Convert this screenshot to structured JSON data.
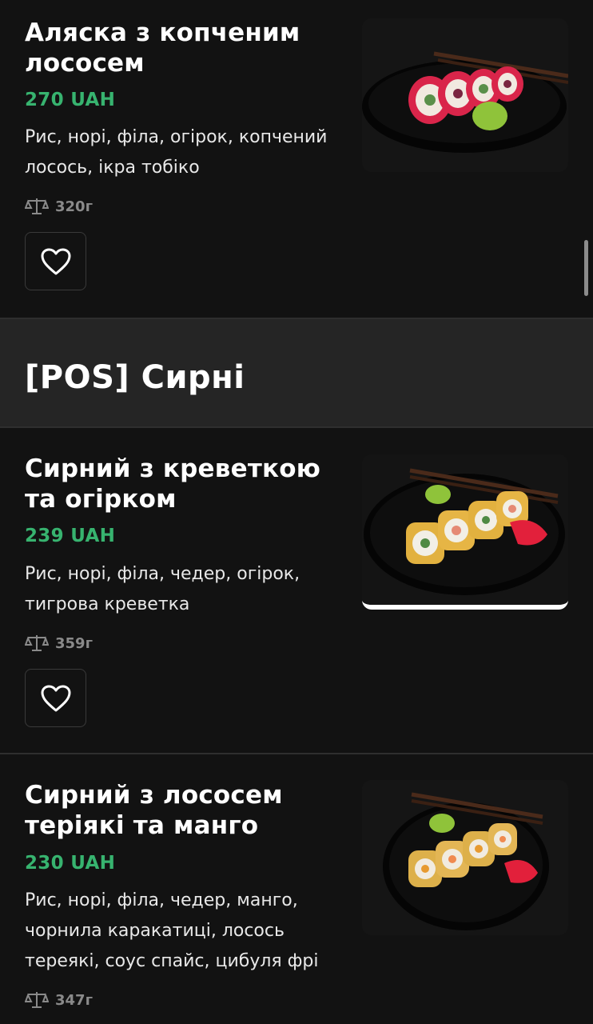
{
  "items": [
    {
      "title": "Аляска з копченим лососем",
      "price": "270 UAH",
      "description": "Рис, норі, філа, огірок, копчений лосось, ікра тобіко",
      "weight": "320г",
      "image_icon": "alaska-roll-photo",
      "fav_icon": "heart-icon"
    },
    {
      "title": "Сирний з креветкою та огірком",
      "price": "239 UAH",
      "description": "Рис, норі, філа, чедер, огірок, тигрова креветка",
      "weight": "359г",
      "image_icon": "shrimp-cheese-roll-photo",
      "fav_icon": "heart-icon"
    },
    {
      "title": "Сирний з лососем теріякі та манго",
      "price": "230 UAH",
      "description": "Рис, норі, філа, чедер, манго, чорнила каракатиці, лосось тереякі, соус спайс, цибуля фрі",
      "weight": "347г",
      "image_icon": "salmon-mango-roll-photo"
    }
  ],
  "category": {
    "title": "[POS] Сирні"
  },
  "colors": {
    "background": "#121212",
    "price": "#37b36f",
    "category_band": "#252525"
  }
}
